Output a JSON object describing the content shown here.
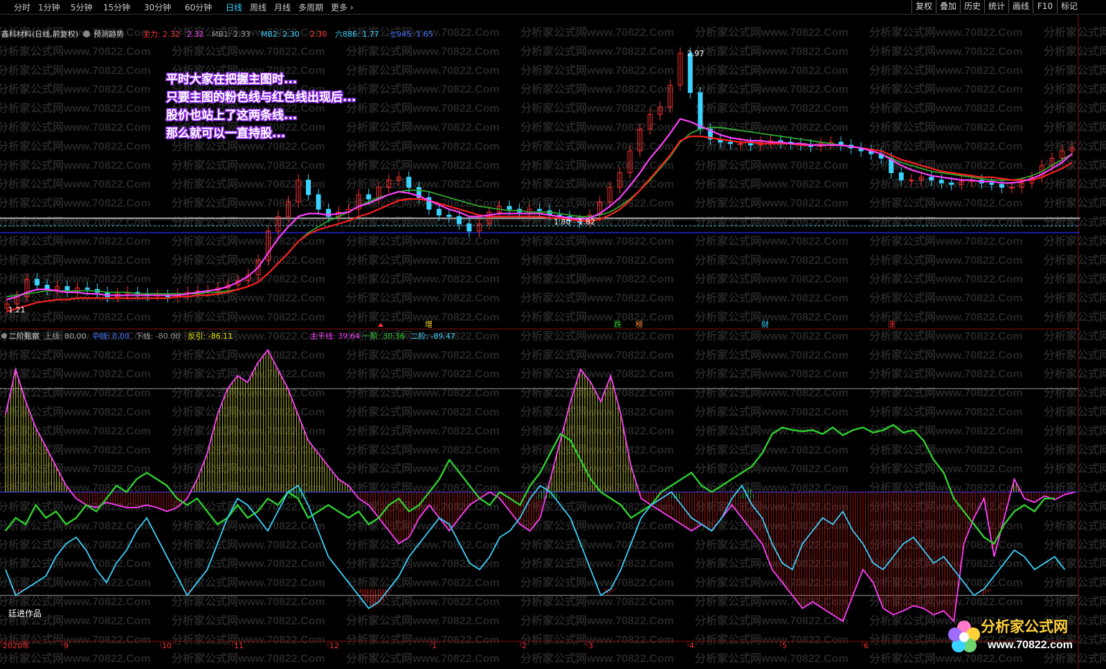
{
  "toolbar": {
    "periods": [
      "分时",
      "1分钟",
      "5分钟",
      "15分钟",
      "30分钟",
      "60分钟",
      "日线",
      "周线",
      "月线",
      "多周期",
      "更多"
    ],
    "active_period": "日线",
    "right_buttons": [
      "复权",
      "叠加",
      "历史",
      "统计",
      "画线",
      "F10",
      "标记"
    ]
  },
  "main_panel": {
    "stock_name": "鑫科材料(日线,前复权)",
    "predict_label": "预测趋势",
    "indicators": [
      {
        "text": "主力: 2.32",
        "color": "#ff3030"
      },
      {
        "text": "2.32",
        "color": "#ff40ff"
      },
      {
        "text": "MB1: 2.33",
        "color": "#9a9a9a"
      },
      {
        "text": "MB2: 2.30",
        "color": "#3ad3ff"
      },
      {
        "text": "2.30",
        "color": "#ff3030"
      },
      {
        "text": "六886: 1.77",
        "color": "#3ad3ff"
      },
      {
        "text": "七945: 1.65",
        "color": "#3a6bff"
      }
    ],
    "annotation_lines": [
      "平时大家在把握主图时...",
      "只要主图的粉色线与红色线出现后...",
      "股价也站上了这两条线...",
      "那么就可以一直持股..."
    ],
    "high_label": "2.97",
    "low_label": "1.21",
    "range_label": "1.80 - 1.82",
    "event_markers": [
      "增",
      "跌",
      "榜",
      "财",
      "涨"
    ]
  },
  "sub_panel": {
    "title": "二阶甄察",
    "indicators": [
      {
        "text": "上线: 80.00",
        "color": "#9a9a9a"
      },
      {
        "text": "中线: 0.00",
        "color": "#3a6bff"
      },
      {
        "text": "下线: -80.00",
        "color": "#9a9a9a"
      },
      {
        "text": "反引: -86.11",
        "color": "#e6e600"
      },
      {
        "text": "主干线: 39.64",
        "color": "#ff40ff"
      },
      {
        "text": "一阶: 30.36",
        "color": "#2fd12f"
      },
      {
        "text": "二阶: -89.47",
        "color": "#3ad3ff"
      }
    ],
    "author": "廷进作品"
  },
  "time_axis": [
    "2020年",
    "9",
    "10",
    "11",
    "12",
    "1",
    "2",
    "3",
    "4",
    "5",
    "6"
  ],
  "watermark": "分析家公式网www.70822.Com",
  "logo": {
    "text": "分析家公式网",
    "url": "www.70822.com"
  },
  "chart_data": [
    {
      "type": "candlestick",
      "title": "鑫科材料(日线,前复权)",
      "ylim": [
        1.15,
        3.05
      ],
      "high": 2.97,
      "low": 1.21,
      "close_series": [
        1.25,
        1.3,
        1.42,
        1.38,
        1.35,
        1.37,
        1.34,
        1.36,
        1.35,
        1.33,
        1.3,
        1.32,
        1.33,
        1.32,
        1.31,
        1.31,
        1.3,
        1.32,
        1.33,
        1.34,
        1.34,
        1.36,
        1.38,
        1.41,
        1.45,
        1.55,
        1.75,
        1.85,
        1.95,
        2.1,
        2.0,
        1.9,
        1.85,
        1.88,
        1.9,
        2.0,
        1.97,
        2.05,
        2.1,
        2.12,
        2.05,
        1.98,
        1.9,
        1.86,
        1.85,
        1.8,
        1.75,
        1.8,
        1.88,
        1.92,
        1.9,
        1.88,
        1.9,
        1.89,
        1.86,
        1.85,
        1.82,
        1.81,
        1.86,
        1.95,
        2.05,
        2.15,
        2.3,
        2.45,
        2.55,
        2.6,
        2.75,
        2.97,
        2.7,
        2.45,
        2.38,
        2.36,
        2.35,
        2.35,
        2.34,
        2.36,
        2.37,
        2.36,
        2.35,
        2.34,
        2.33,
        2.35,
        2.36,
        2.34,
        2.32,
        2.3,
        2.28,
        2.25,
        2.15,
        2.1,
        2.1,
        2.12,
        2.1,
        2.08,
        2.07,
        2.09,
        2.1,
        2.08,
        2.07,
        2.05,
        2.05,
        2.08,
        2.12,
        2.2,
        2.25,
        2.3,
        2.32
      ],
      "ma_pink": [
        1.28,
        1.3,
        1.33,
        1.35,
        1.35,
        1.34,
        1.33,
        1.33,
        1.32,
        1.32,
        1.31,
        1.31,
        1.31,
        1.31,
        1.31,
        1.31,
        1.31,
        1.31,
        1.32,
        1.33,
        1.34,
        1.35,
        1.37,
        1.4,
        1.44,
        1.5,
        1.6,
        1.7,
        1.78,
        1.85,
        1.87,
        1.87,
        1.86,
        1.87,
        1.88,
        1.92,
        1.94,
        1.97,
        2.0,
        2.02,
        2.01,
        1.99,
        1.96,
        1.93,
        1.9,
        1.88,
        1.85,
        1.85,
        1.86,
        1.87,
        1.87,
        1.87,
        1.87,
        1.87,
        1.86,
        1.85,
        1.84,
        1.83,
        1.84,
        1.87,
        1.92,
        1.98,
        2.06,
        2.15,
        2.25,
        2.33,
        2.42,
        2.52,
        2.5,
        2.47,
        2.44,
        2.41,
        2.39,
        2.38,
        2.37,
        2.37,
        2.36,
        2.36,
        2.35,
        2.35,
        2.34,
        2.34,
        2.34,
        2.34,
        2.33,
        2.32,
        2.3,
        2.28,
        2.24,
        2.2,
        2.17,
        2.15,
        2.13,
        2.12,
        2.11,
        2.1,
        2.1,
        2.09,
        2.09,
        2.08,
        2.08,
        2.09,
        2.11,
        2.14,
        2.18,
        2.22,
        2.28
      ],
      "ma_red": [
        1.2,
        1.22,
        1.24,
        1.26,
        1.27,
        1.28,
        1.28,
        1.29,
        1.29,
        1.29,
        1.29,
        1.29,
        1.29,
        1.29,
        1.29,
        1.29,
        1.29,
        1.3,
        1.3,
        1.31,
        1.31,
        1.32,
        1.33,
        1.35,
        1.37,
        1.4,
        1.46,
        1.53,
        1.6,
        1.68,
        1.73,
        1.76,
        1.78,
        1.8,
        1.82,
        1.85,
        1.87,
        1.9,
        1.93,
        1.96,
        1.97,
        1.97,
        1.96,
        1.94,
        1.92,
        1.9,
        1.88,
        1.86,
        1.85,
        1.85,
        1.85,
        1.85,
        1.85,
        1.85,
        1.84,
        1.84,
        1.83,
        1.82,
        1.82,
        1.83,
        1.86,
        1.9,
        1.96,
        2.03,
        2.11,
        2.19,
        2.27,
        2.37,
        2.4,
        2.4,
        2.39,
        2.38,
        2.37,
        2.36,
        2.36,
        2.35,
        2.35,
        2.35,
        2.35,
        2.34,
        2.34,
        2.34,
        2.34,
        2.34,
        2.33,
        2.32,
        2.31,
        2.3,
        2.27,
        2.24,
        2.22,
        2.2,
        2.18,
        2.16,
        2.15,
        2.14,
        2.13,
        2.12,
        2.12,
        2.11,
        2.1,
        2.1,
        2.1,
        2.12,
        2.15,
        2.18,
        2.22
      ],
      "ma_green": [
        1.3,
        1.31,
        1.32,
        1.33,
        1.34,
        1.34,
        1.34,
        1.34,
        1.34,
        1.34,
        1.33,
        1.33,
        1.33,
        1.32,
        1.32,
        1.32,
        1.32,
        1.32,
        1.32,
        1.32,
        1.33,
        1.33,
        1.34,
        1.35,
        1.37,
        1.4,
        1.46,
        1.53,
        1.6,
        1.68,
        1.74,
        1.78,
        1.82,
        1.85,
        1.88,
        1.92,
        1.95,
        1.98,
        2.0,
        2.02,
        2.03,
        2.03,
        2.02,
        2.0,
        1.98,
        1.96,
        1.94,
        1.92,
        1.91,
        1.9,
        1.89,
        1.89,
        1.88,
        1.88,
        1.88,
        1.87,
        1.86,
        1.85,
        1.85,
        1.86,
        1.88,
        1.92,
        1.97,
        2.03,
        2.1,
        2.18,
        2.26,
        2.36,
        2.42,
        2.45,
        2.46,
        2.46,
        2.45,
        2.44,
        2.43,
        2.42,
        2.41,
        2.4,
        2.39,
        2.38,
        2.37,
        2.36,
        2.35,
        2.34,
        2.33,
        2.32,
        2.3,
        2.28,
        2.25,
        2.22,
        2.2,
        2.18,
        2.16,
        2.15,
        2.14,
        2.13,
        2.12,
        2.11,
        2.1,
        2.1,
        2.1,
        2.11,
        2.13,
        2.16,
        2.2,
        2.24,
        2.28
      ]
    },
    {
      "type": "line",
      "title": "二阶甄察",
      "ylim": [
        -115,
        115
      ],
      "levels": {
        "上线": 80,
        "中线": 0,
        "下线": -80
      },
      "series": [
        {
          "name": "主干线",
          "color": "#ff40ff",
          "values": [
            60,
            95,
            70,
            50,
            35,
            20,
            5,
            -5,
            -10,
            -12,
            -8,
            -10,
            -12,
            -12,
            -10,
            -12,
            -15,
            -12,
            -5,
            10,
            30,
            60,
            80,
            90,
            85,
            100,
            110,
            95,
            80,
            60,
            40,
            30,
            20,
            10,
            5,
            -5,
            -10,
            -20,
            -30,
            -40,
            -35,
            -20,
            -10,
            -20,
            -30,
            -20,
            -10,
            -5,
            0,
            -5,
            -15,
            -25,
            -30,
            -20,
            10,
            40,
            70,
            95,
            85,
            70,
            90,
            60,
            20,
            -5,
            -10,
            -15,
            -20,
            -25,
            -30,
            -25,
            -30,
            -20,
            -10,
            -20,
            -30,
            -40,
            -60,
            -70,
            -80,
            -90,
            -85,
            -90,
            -95,
            -100,
            -80,
            -60,
            -70,
            -90,
            -95,
            -92,
            -88,
            -90,
            -95,
            -92,
            -100,
            -40,
            -20,
            -5,
            -50,
            -20,
            10,
            -5,
            -8,
            -3,
            -6,
            -2,
            0
          ]
        },
        {
          "name": "一阶",
          "color": "#2fd12f",
          "values": [
            -30,
            -20,
            -25,
            -10,
            -20,
            -15,
            -25,
            -20,
            -10,
            -15,
            -5,
            5,
            0,
            10,
            15,
            10,
            5,
            -5,
            -10,
            -5,
            -15,
            -25,
            -20,
            -10,
            -20,
            -15,
            -5,
            -10,
            0,
            -5,
            -20,
            -15,
            -10,
            -15,
            -20,
            -15,
            -25,
            -20,
            -10,
            -5,
            -15,
            -10,
            0,
            10,
            25,
            15,
            5,
            -5,
            -10,
            0,
            -5,
            -10,
            5,
            15,
            30,
            45,
            40,
            25,
            10,
            0,
            -5,
            -10,
            -20,
            -15,
            -10,
            0,
            5,
            10,
            15,
            5,
            0,
            5,
            10,
            15,
            20,
            30,
            45,
            50,
            48,
            47,
            48,
            45,
            50,
            44,
            48,
            50,
            46,
            48,
            52,
            46,
            48,
            40,
            25,
            15,
            -5,
            -15,
            -25,
            -35,
            -40,
            -25,
            -15,
            -10,
            -15,
            -5,
            -5
          ]
        },
        {
          "name": "二阶",
          "color": "#3ad3ff",
          "values": [
            -60,
            -80,
            -75,
            -70,
            -65,
            -50,
            -40,
            -35,
            -45,
            -60,
            -70,
            -55,
            -45,
            -30,
            -20,
            -35,
            -50,
            -65,
            -80,
            -70,
            -60,
            -40,
            -20,
            -5,
            -10,
            -20,
            -30,
            -15,
            0,
            5,
            -10,
            -30,
            -50,
            -60,
            -70,
            -80,
            -90,
            -85,
            -75,
            -65,
            -50,
            -40,
            -30,
            -20,
            -25,
            -40,
            -55,
            -60,
            -50,
            -35,
            -30,
            -20,
            -5,
            5,
            0,
            -10,
            -20,
            -40,
            -60,
            -80,
            -75,
            -60,
            -40,
            -20,
            -10,
            -5,
            0,
            -10,
            -20,
            -25,
            -30,
            -20,
            -5,
            5,
            -10,
            -20,
            -40,
            -55,
            -60,
            -40,
            -30,
            -20,
            -25,
            -15,
            -30,
            -40,
            -55,
            -60,
            -50,
            -40,
            -35,
            -45,
            -55,
            -50,
            -60,
            -70,
            -80,
            -75,
            -65,
            -55,
            -45,
            -50,
            -60,
            -55,
            -50,
            -60
          ]
        }
      ]
    }
  ]
}
